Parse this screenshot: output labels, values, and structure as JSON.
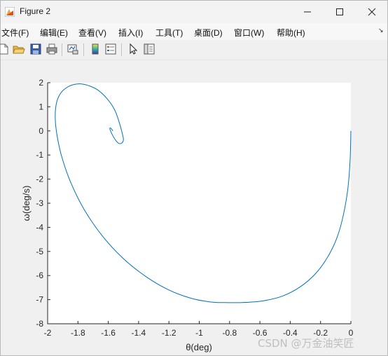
{
  "window": {
    "title": "Figure 2",
    "icons": {
      "app": "matlab-figure-icon",
      "minimize": "minimize-icon",
      "maximize": "maximize-icon",
      "close": "close-icon"
    }
  },
  "menubar": {
    "items": [
      {
        "label": "文件(F)"
      },
      {
        "label": "编辑(E)"
      },
      {
        "label": "查看(V)"
      },
      {
        "label": "插入(I)"
      },
      {
        "label": "工具(T)"
      },
      {
        "label": "桌面(D)"
      },
      {
        "label": "窗口(W)"
      },
      {
        "label": "帮助(H)"
      }
    ],
    "overflow_icon": "dock-arrow-icon",
    "overflow_glyph": "↘"
  },
  "toolbar": {
    "buttons": [
      {
        "icon": "new-figure-icon"
      },
      {
        "icon": "open-file-icon"
      },
      {
        "icon": "save-icon"
      },
      {
        "icon": "print-icon"
      },
      {
        "icon": "link-plot-icon"
      },
      {
        "icon": "insert-colorbar-icon"
      },
      {
        "icon": "insert-legend-icon"
      },
      {
        "icon": "edit-plot-icon"
      },
      {
        "icon": "property-editor-icon"
      }
    ]
  },
  "chart_data": {
    "type": "line",
    "xlabel": "θ(deg)",
    "ylabel": "ω(deg/s)",
    "xlim": [
      -2,
      0
    ],
    "ylim": [
      -8,
      2
    ],
    "xticks": [
      "-2",
      "-1.8",
      "-1.6",
      "-1.4",
      "-1.2",
      "-1",
      "-0.8",
      "-0.6",
      "-0.4",
      "-0.2",
      "0"
    ],
    "yticks": [
      "2",
      "1",
      "0",
      "-1",
      "-2",
      "-3",
      "-4",
      "-5",
      "-6",
      "-7",
      "-8"
    ],
    "grid": false,
    "series": [
      {
        "color": "#0072bd",
        "x": [
          0,
          -0.005,
          -0.02,
          -0.05,
          -0.09,
          -0.15,
          -0.23,
          -0.33,
          -0.45,
          -0.58,
          -0.72,
          -0.85,
          -0.92,
          -1.05,
          -1.2,
          -1.35,
          -1.5,
          -1.64,
          -1.76,
          -1.85,
          -1.91,
          -1.94,
          -1.95,
          -1.94,
          -1.91,
          -1.86,
          -1.8,
          -1.74,
          -1.67,
          -1.61,
          -1.56,
          -1.53,
          -1.51,
          -1.5,
          -1.51,
          -1.53,
          -1.55,
          -1.57,
          -1.585,
          -1.59,
          -1.585,
          -1.575,
          -1.57
        ],
        "y": [
          0,
          -1.2,
          -2.4,
          -3.5,
          -4.4,
          -5.2,
          -5.9,
          -6.45,
          -6.85,
          -7.05,
          -7.12,
          -7.12,
          -7.1,
          -6.95,
          -6.6,
          -6.05,
          -5.3,
          -4.35,
          -3.25,
          -2.1,
          -1.0,
          -0.1,
          0.6,
          1.2,
          1.6,
          1.85,
          1.95,
          1.9,
          1.7,
          1.35,
          0.9,
          0.4,
          -0.05,
          -0.35,
          -0.5,
          -0.52,
          -0.4,
          -0.2,
          0.0,
          0.1,
          0.12,
          0.05,
          0.0
        ]
      }
    ]
  },
  "watermark": "CSDN @万金油笑匠"
}
